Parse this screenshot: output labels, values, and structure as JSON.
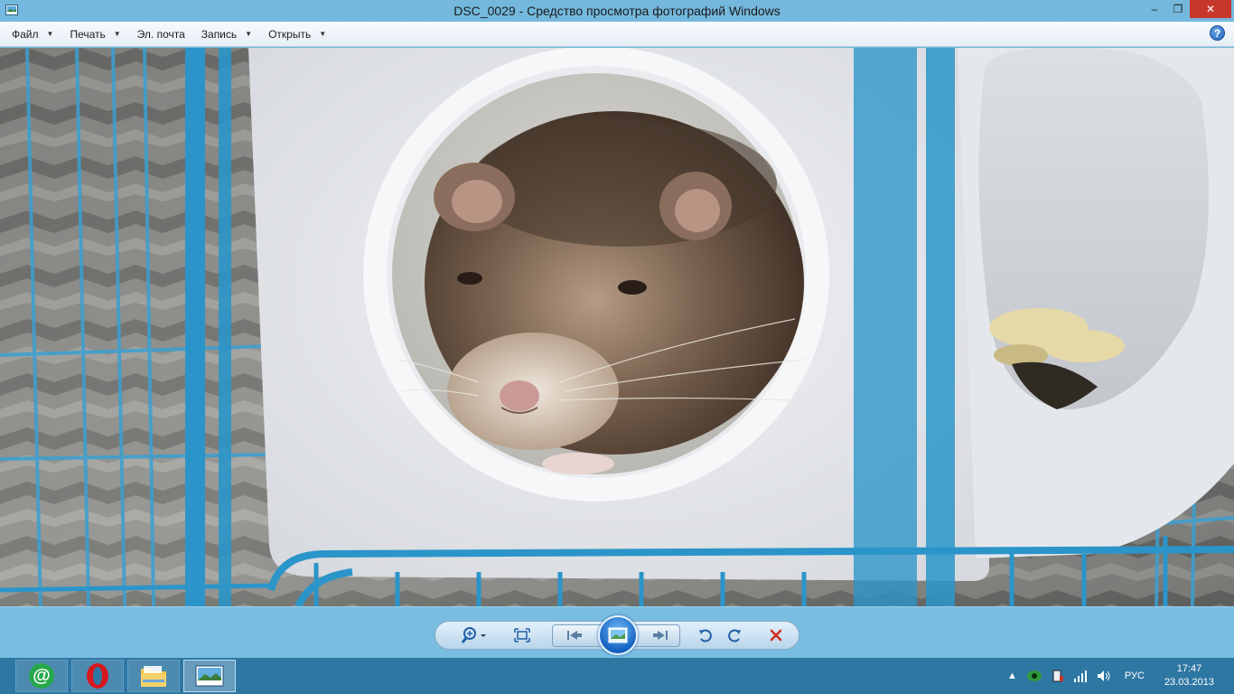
{
  "window": {
    "title": "DSC_0029 - Средство просмотра фотографий Windows",
    "minimize_glyph": "‒",
    "restore_glyph": "❐",
    "close_glyph": "✕"
  },
  "menu": {
    "items": [
      {
        "label": "Файл",
        "has_dropdown": true
      },
      {
        "label": "Печать",
        "has_dropdown": true
      },
      {
        "label": "Эл. почта",
        "has_dropdown": false
      },
      {
        "label": "Запись",
        "has_dropdown": true
      },
      {
        "label": "Открыть",
        "has_dropdown": true
      }
    ],
    "help_glyph": "?"
  },
  "controls": {
    "icons": [
      "zoom-icon",
      "fit-to-window-icon",
      "previous-icon",
      "slideshow-icon",
      "next-icon",
      "rotate-left-icon",
      "rotate-right-icon",
      "delete-icon"
    ],
    "delete_color": "#d42a1a"
  },
  "taskbar": {
    "apps": [
      {
        "name": "mail-agent",
        "icon": "at-icon"
      },
      {
        "name": "opera",
        "icon": "opera-icon"
      },
      {
        "name": "file-explorer",
        "icon": "folder-icon"
      },
      {
        "name": "photo-viewer",
        "icon": "photo-viewer-icon",
        "active": true
      }
    ],
    "tray": {
      "language": "РУС",
      "time": "17:47",
      "date": "23.03.2013"
    }
  },
  "colors": {
    "titlebar": "#74b8dd",
    "close_button": "#c7372c",
    "taskbar": "#2f77a3",
    "cage_bars": "#2b95c9"
  }
}
